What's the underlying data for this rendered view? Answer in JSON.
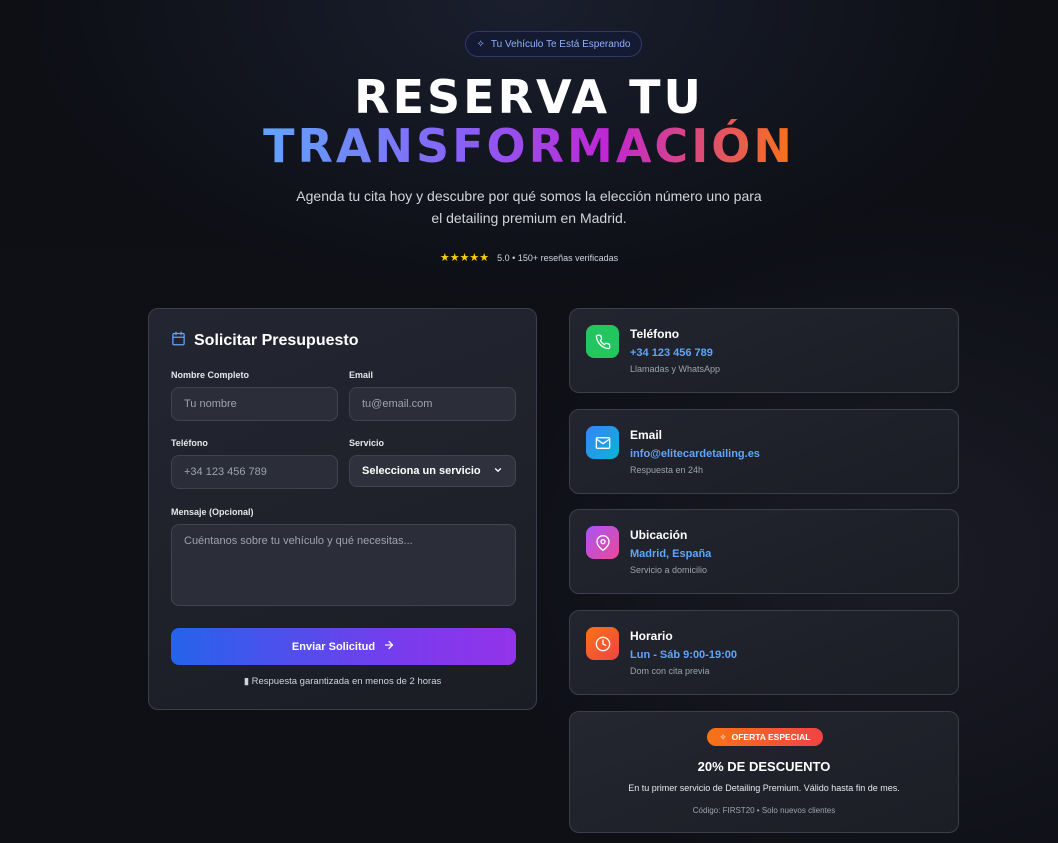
{
  "header": {
    "badge": "Tu Vehículo Te Está Esperando",
    "title_line1": "RESERVA TU",
    "title_line2": "TRANSFORMACIÓN",
    "subtitle": "Agenda tu cita hoy y descubre por qué somos la elección número uno para el detailing premium en Madrid.",
    "stars": "★★★★★",
    "rating_text": "5.0 • 150+ reseñas verificadas"
  },
  "form": {
    "title": "Solicitar Presupuesto",
    "name_label": "Nombre Completo",
    "name_placeholder": "Tu nombre",
    "email_label": "Email",
    "email_placeholder": "tu@email.com",
    "phone_label": "Teléfono",
    "phone_placeholder": "+34 123 456 789",
    "service_label": "Servicio",
    "service_selected": "Selecciona un servicio",
    "message_label": "Mensaje (Opcional)",
    "message_placeholder": "Cuéntanos sobre tu vehículo y qué necesitas...",
    "submit_label": "Enviar Solicitud",
    "note": "Respuesta garantizada en menos de 2 horas"
  },
  "contact": [
    {
      "title": "Teléfono",
      "value": "+34 123 456 789",
      "sub": "Llamadas y WhatsApp",
      "icon": "phone-icon",
      "color": "#22c55e"
    },
    {
      "title": "Email",
      "value": "info@elitecardetailing.es",
      "sub": "Respuesta en 24h",
      "icon": "mail-icon",
      "color": "#3b82f6"
    },
    {
      "title": "Ubicación",
      "value": "Madrid, España",
      "sub": "Servicio a domicilio",
      "icon": "location-pin-icon",
      "color": "#c026d3"
    },
    {
      "title": "Horario",
      "value": "Lun - Sáb 9:00-19:00",
      "sub": "Dom con cita previa",
      "icon": "clock-icon",
      "color": "#f97316"
    }
  ],
  "offer": {
    "badge": "OFERTA ESPECIAL",
    "title": "20% DE DESCUENTO",
    "text": "En tu primer servicio de Detailing Premium. Válido hasta fin de mes.",
    "code": "Código: FIRST20 • Solo nuevos clientes"
  }
}
